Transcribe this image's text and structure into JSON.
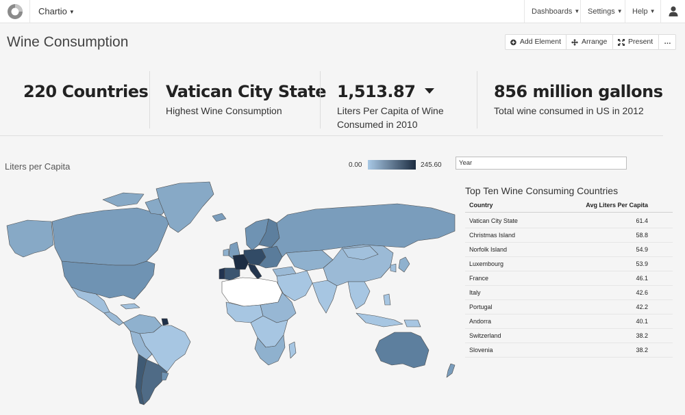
{
  "nav": {
    "brand": "Chartio",
    "items": [
      {
        "label": "Dashboards"
      },
      {
        "label": "Settings"
      },
      {
        "label": "Help"
      }
    ]
  },
  "page": {
    "title": "Wine Consumption"
  },
  "toolbar": {
    "add_label": "Add Element",
    "arrange_label": "Arrange",
    "present_label": "Present",
    "more_label": "…"
  },
  "kpis": [
    {
      "value": "220 Countries",
      "label": ""
    },
    {
      "value": "Vatican City State",
      "label": "Highest Wine Consumption"
    },
    {
      "value": "1,513.87",
      "label": "Liters Per Capita of Wine Consumed in 2010",
      "trend": "down"
    },
    {
      "value": "856 million gallons",
      "label": "Total wine consumed in US in 2012"
    }
  ],
  "map": {
    "title": "Liters per Capita",
    "legend_min": "0.00",
    "legend_max": "245.60",
    "colors": {
      "low": "#a9c9e6",
      "high": "#1c2c40",
      "no_data": "#ffffff",
      "border": "#555555"
    }
  },
  "filter": {
    "year_placeholder": "Year"
  },
  "top_ten": {
    "title": "Top Ten Wine Consuming Countries",
    "columns": [
      "Country",
      "Avg Liters Per Capita"
    ],
    "rows": [
      {
        "country": "Vatican City State",
        "value": "61.4"
      },
      {
        "country": "Christmas Island",
        "value": "58.8"
      },
      {
        "country": "Norfolk Island",
        "value": "54.9"
      },
      {
        "country": "Luxembourg",
        "value": "53.9"
      },
      {
        "country": "France",
        "value": "46.1"
      },
      {
        "country": "Italy",
        "value": "42.6"
      },
      {
        "country": "Portugal",
        "value": "42.2"
      },
      {
        "country": "Andorra",
        "value": "40.1"
      },
      {
        "country": "Switzerland",
        "value": "38.2"
      },
      {
        "country": "Slovenia",
        "value": "38.2"
      }
    ]
  }
}
